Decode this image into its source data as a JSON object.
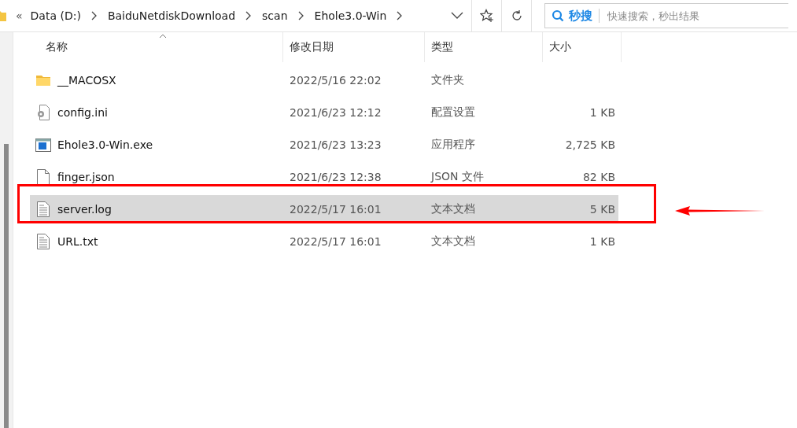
{
  "address_bar": {
    "overflow": "«",
    "crumbs": [
      "Data (D:)",
      "BaiduNetdiskDownload",
      "scan",
      "Ehole3.0-Win"
    ]
  },
  "search": {
    "brand": "秒搜",
    "placeholder": "快速搜索，秒出结果"
  },
  "columns": [
    "名称",
    "修改日期",
    "类型",
    "大小"
  ],
  "files": [
    {
      "kind": "folder",
      "name": "__MACOSX",
      "date": "2022/5/16 22:02",
      "type": "文件夹",
      "selected": false,
      "annotated": false
    },
    {
      "kind": "config",
      "name": "config.ini",
      "date": "2021/6/23 12:12",
      "type": "配置设置",
      "size": "1 KB",
      "selected": false,
      "annotated": false
    },
    {
      "kind": "exe",
      "name": "Ehole3.0-Win.exe",
      "date": "2021/6/23 13:23",
      "type": "应用程序",
      "size": "2,725 KB",
      "selected": false,
      "annotated": false
    },
    {
      "kind": "file",
      "name": "finger.json",
      "date": "2021/6/23 12:38",
      "type": "JSON 文件",
      "size": "82 KB",
      "selected": false,
      "annotated": false
    },
    {
      "kind": "text",
      "name": "server.log",
      "date": "2022/5/17 16:01",
      "type": "文本文档",
      "size": "5 KB",
      "selected": true,
      "annotated": true
    },
    {
      "kind": "text",
      "name": "URL.txt",
      "date": "2022/5/17 16:01",
      "type": "文本文档",
      "size": "1 KB",
      "selected": false,
      "annotated": false
    }
  ]
}
